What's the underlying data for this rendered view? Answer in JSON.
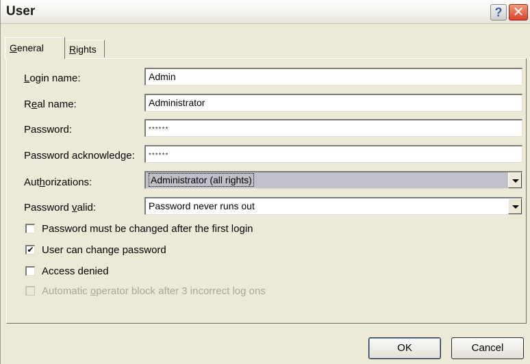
{
  "window": {
    "title": "User"
  },
  "titlebar": {
    "help_glyph": "?",
    "close_glyph": "✕"
  },
  "tabs": [
    {
      "label": "General",
      "accel": "G",
      "rest": "eneral",
      "active": true
    },
    {
      "label": "Rights",
      "accel": "R",
      "rest": "ights",
      "active": false
    }
  ],
  "form": {
    "login_name": {
      "label_pre": "",
      "label_accel": "L",
      "label_post": "ogin name:",
      "value": "Admin"
    },
    "real_name": {
      "label_pre": "R",
      "label_accel": "e",
      "label_post": "al name:",
      "value": "Administrator"
    },
    "password": {
      "label": "Password:",
      "value": "******"
    },
    "password_ack": {
      "label": "Password acknowledge:",
      "value": "******"
    },
    "authorizations": {
      "label_pre": "Aut",
      "label_accel": "h",
      "label_post": "orizations:",
      "value": "Administrator (all rights)"
    },
    "password_valid": {
      "label_pre": "Password ",
      "label_accel": "v",
      "label_post": "alid:",
      "value": "Password never runs out"
    }
  },
  "checkboxes": [
    {
      "label": "Password must be changed after the first login",
      "checked": false,
      "enabled": true
    },
    {
      "label": "User can change password",
      "checked": true,
      "enabled": true
    },
    {
      "label": "Access denied",
      "checked": false,
      "enabled": true
    },
    {
      "label_pre": "Automatic ",
      "label_accel": "o",
      "label_post": "perator block after 3 incorrect log ons",
      "checked": false,
      "enabled": false
    }
  ],
  "check_glyph": "✔",
  "buttons": {
    "ok": "OK",
    "cancel": "Cancel"
  }
}
